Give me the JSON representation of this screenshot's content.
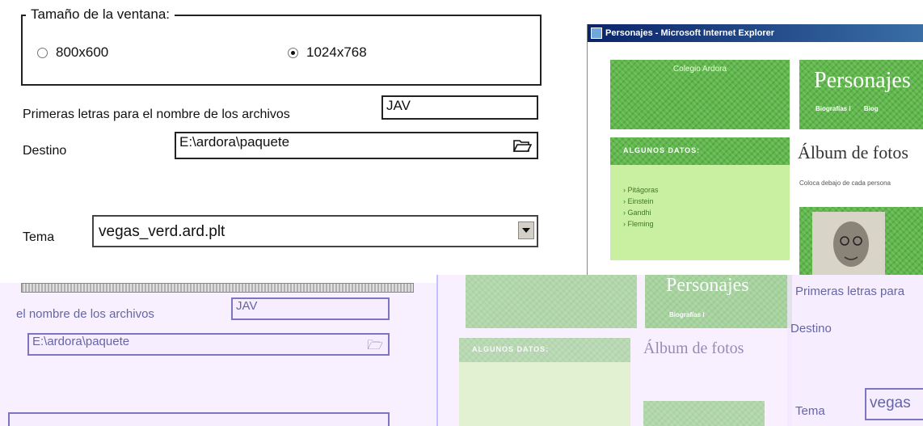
{
  "window_size": {
    "legend": "Tamaño de la ventana:",
    "options": [
      {
        "label": "800x600",
        "selected": false
      },
      {
        "label": "1024x768",
        "selected": true
      }
    ]
  },
  "prefix": {
    "label": "Primeras letras para el nombre de los archivos",
    "value": "JAV"
  },
  "destination": {
    "label": "Destino",
    "value": "E:\\ardora\\paquete"
  },
  "theme": {
    "label": "Tema",
    "value": "vegas_verd.ard.plt"
  },
  "preview": {
    "window_title": "Personajes - Microsoft Internet Explorer",
    "site_name": "Colegio Ardora",
    "page_title": "Personajes",
    "nav": [
      "Biografías I",
      "Biog"
    ],
    "sidebar_heading": "ALGUNOS DATOS:",
    "sidebar_links": [
      "Pitágoras",
      "Einstein",
      "Gandhi",
      "Fleming"
    ],
    "section_title": "Álbum de fotos",
    "instruction": "Coloca debajo de cada persona"
  },
  "overlay": {
    "prefix_label_tail": "el nombre de los archivos",
    "prefix_value": "JAV",
    "destination_value": "E:\\ardora\\paquete",
    "page_title": "Personajes",
    "nav": "Biografías I",
    "sidebar_heading": "ALGUNOS DATOS:",
    "section_title": "Álbum de fotos",
    "right_prefix_label": "Primeras letras para",
    "right_destination_label": "Destino",
    "right_theme_label": "Tema",
    "right_theme_value": "vegas"
  },
  "colors": {
    "grass": "#5eb84a",
    "light_green": "#c8f0a0",
    "overlay_tint": "#f4e8ff"
  }
}
